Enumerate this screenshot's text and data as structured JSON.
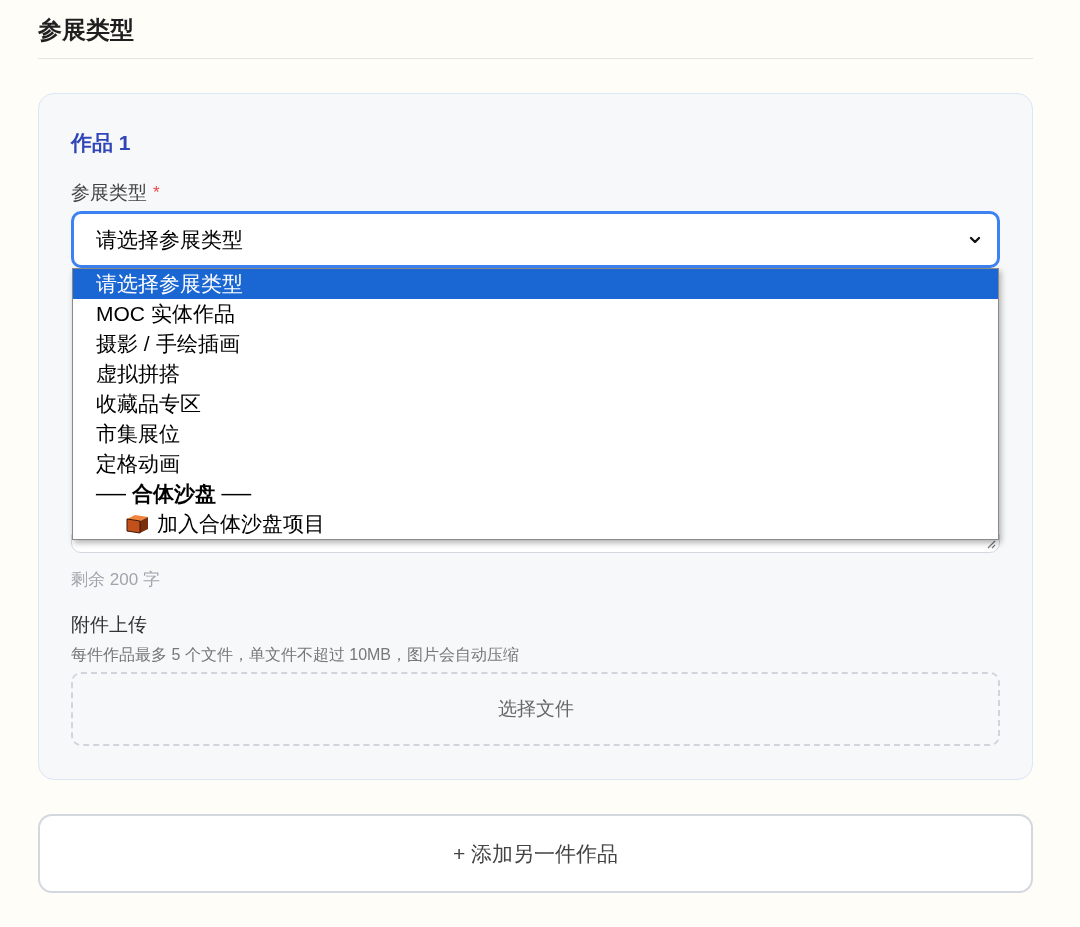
{
  "section_title": "参展类型",
  "work_card": {
    "title": "作品 1",
    "type_field": {
      "label": "参展类型",
      "required_mark": "*",
      "value": "请选择参展类型",
      "expanded": true,
      "options": [
        {
          "kind": "option",
          "label": "请选择参展类型",
          "selected": true
        },
        {
          "kind": "option",
          "label": "MOC 实体作品",
          "selected": false
        },
        {
          "kind": "option",
          "label": "摄影 / 手绘插画",
          "selected": false
        },
        {
          "kind": "option",
          "label": "虚拟拼搭",
          "selected": false
        },
        {
          "kind": "option",
          "label": "收藏品专区",
          "selected": false
        },
        {
          "kind": "option",
          "label": "市集展位",
          "selected": false
        },
        {
          "kind": "option",
          "label": "定格动画",
          "selected": false
        },
        {
          "kind": "group",
          "label": "── **合体沙盘** ──",
          "selected": false
        },
        {
          "kind": "suboption",
          "label": "加入合体沙盘项目",
          "selected": false
        }
      ]
    },
    "description_field": {
      "counter": "剩余 200 字"
    },
    "attachments": {
      "label": "附件上传",
      "hint": "每件作品最多 5 个文件，单文件不超过 10MB，图片会自动压缩",
      "button": "选择文件"
    }
  },
  "add_button": "+ 添加另一件作品"
}
